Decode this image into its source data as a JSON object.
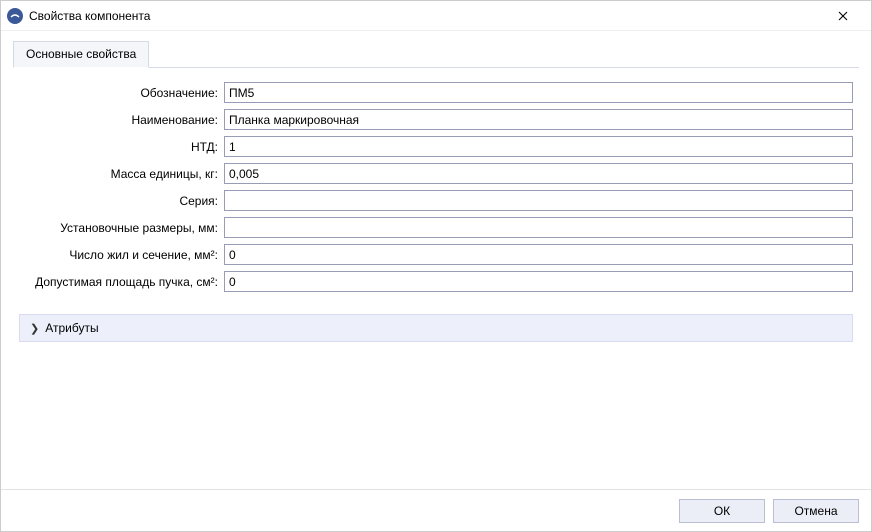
{
  "window": {
    "title": "Свойства компонента"
  },
  "tabs": {
    "main": "Основные свойства"
  },
  "form": {
    "designation_label": "Обозначение:",
    "designation_value": "ПМ5",
    "name_label": "Наименование:",
    "name_value": "Планка маркировочная",
    "ntd_label": "НТД:",
    "ntd_value": "1",
    "mass_label": "Масса единицы, кг:",
    "mass_value": "0,005",
    "series_label": "Серия:",
    "series_value": "",
    "mount_label": "Установочные размеры, мм:",
    "mount_value": "",
    "wires_label": "Число жил и сечение, мм²:",
    "wires_value": "0",
    "area_label": "Допустимая площадь пучка, см²:",
    "area_value": "0"
  },
  "collapser": {
    "attributes": "Атрибуты"
  },
  "footer": {
    "ok": "ОК",
    "cancel": "Отмена"
  }
}
